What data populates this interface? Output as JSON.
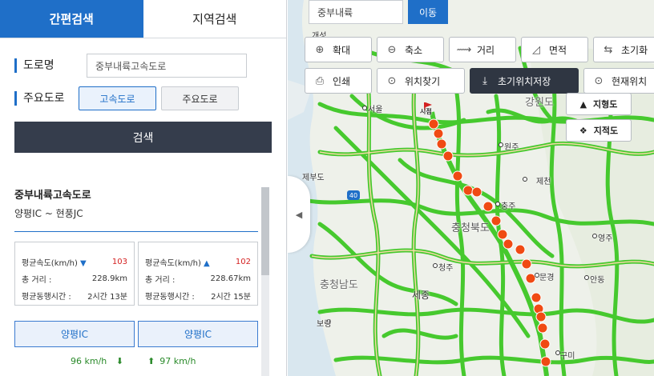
{
  "tabs": [
    {
      "label": "간편검색",
      "active": true
    },
    {
      "label": "지역검색",
      "active": false
    }
  ],
  "form": {
    "road_label": "도로명",
    "road_value": "중부내륙고속도로",
    "main_road_label": "주요도로",
    "road_types": [
      "고속도로",
      "주요도로"
    ],
    "selected_type": "고속도로",
    "search_button": "검색"
  },
  "result": {
    "title": "중부내륙고속도로",
    "section": "양평IC ~ 현풍JC",
    "cards": [
      {
        "speed_label": "평균속도(km/h)",
        "direction": "down",
        "speed": "103",
        "distance_label": "총 거리 :",
        "distance": "228.9km",
        "time_label": "평균동행시간 :",
        "time": "2시간 13분",
        "ic_button": "양평IC",
        "speed_text": "96 km/h"
      },
      {
        "speed_label": "평균속도(km/h)",
        "direction": "up",
        "speed": "102",
        "distance_label": "총 거리 :",
        "distance": "228.67km",
        "time_label": "평균동행시간 :",
        "time": "2시간 15분",
        "ic_button": "양평IC",
        "speed_text": "97 km/h"
      }
    ]
  },
  "map": {
    "search_value": "중부내륙",
    "go_button": "이동",
    "toolbar_row1": [
      "확대",
      "축소",
      "거리",
      "면적",
      "초기화"
    ],
    "toolbar_row2": [
      "인쇄",
      "위치찾기",
      "초기위치저장",
      "현재위치"
    ],
    "map_types": [
      "지형도",
      "지적도"
    ],
    "labels": [
      "개성",
      "서울",
      "강원도",
      "시점",
      "원주",
      "제천",
      "충청북도",
      "충주",
      "영주",
      "청주",
      "충청남도",
      "세종",
      "문경",
      "안동",
      "보령",
      "구미",
      "제부도"
    ],
    "road_color": "#46c92e",
    "marker_color": "#f04a13"
  }
}
